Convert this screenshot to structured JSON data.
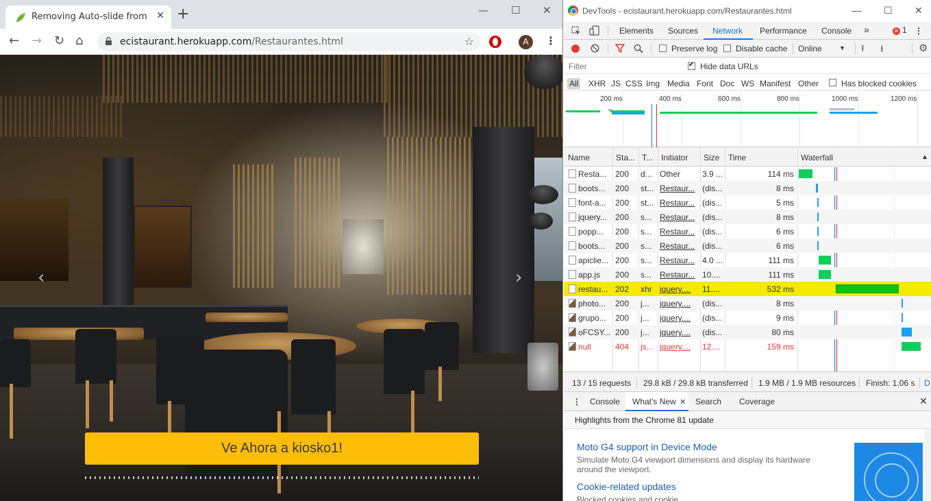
{
  "browser": {
    "tab_title": "Removing Auto-slide from Boots",
    "tab_close": "✕",
    "new_tab": "+",
    "win_min": "—",
    "win_max": "☐",
    "win_close": "✕",
    "url_host": "ecistaurant.herokuapp.com",
    "url_path": "/Restaurantes.html",
    "avatar_letter": "A",
    "back": "←",
    "forward": "→",
    "reload": "↻",
    "home": "⌂",
    "star": "☆",
    "menu": "⋮"
  },
  "page": {
    "cta_label": "Ve Ahora a kiosko1!",
    "prev_arrow": "‹",
    "next_arrow": "›"
  },
  "devtools": {
    "window_title": "DevTools - ecistaurant.herokuapp.com/Restaurantes.html",
    "win_min": "—",
    "win_max": "☐",
    "win_close": "✕",
    "tabs": [
      "Elements",
      "Sources",
      "Network",
      "Performance",
      "Console"
    ],
    "more_tabs": "»",
    "error_count": "1",
    "menu": "⋮",
    "close": "✕",
    "toolbar": {
      "preserve_log": "Preserve log",
      "disable_cache": "Disable cache",
      "throttle": "Online",
      "throttle_caret": "▼"
    },
    "filter_placeholder": "Filter",
    "hide_data_urls": "Hide data URLs",
    "types": [
      "All",
      "XHR",
      "JS",
      "CSS",
      "Img",
      "Media",
      "Font",
      "Doc",
      "WS",
      "Manifest",
      "Other"
    ],
    "has_blocked_cookies": "Has blocked cookies",
    "overview_ticks": [
      "200 ms",
      "400 ms",
      "600 ms",
      "800 ms",
      "1000 ms",
      "1200 ms"
    ],
    "columns": [
      "Name",
      "Sta...",
      "T...",
      "Initiator",
      "Size",
      "Time",
      "Waterfall"
    ],
    "sort_arrow": "▲",
    "rows": [
      {
        "name": "Resta...",
        "status": "200",
        "type": "d...",
        "initiator": "Other",
        "size": "3.9 ...",
        "time": "114 ms"
      },
      {
        "name": "boots...",
        "status": "200",
        "type": "st...",
        "initiator": "Restaur...",
        "size": "(dis...",
        "time": "8 ms"
      },
      {
        "name": "font-a...",
        "status": "200",
        "type": "st...",
        "initiator": "Restaur...",
        "size": "(dis...",
        "time": "5 ms"
      },
      {
        "name": "jquery...",
        "status": "200",
        "type": "s...",
        "initiator": "Restaur...",
        "size": "(dis...",
        "time": "8 ms"
      },
      {
        "name": "popp...",
        "status": "200",
        "type": "s...",
        "initiator": "Restaur...",
        "size": "(dis...",
        "time": "6 ms"
      },
      {
        "name": "boots...",
        "status": "200",
        "type": "s...",
        "initiator": "Restaur...",
        "size": "(dis...",
        "time": "6 ms"
      },
      {
        "name": "apiclie...",
        "status": "200",
        "type": "s...",
        "initiator": "Restaur...",
        "size": "4.0 ...",
        "time": "111 ms"
      },
      {
        "name": "app.js",
        "status": "200",
        "type": "s...",
        "initiator": "Restaur...",
        "size": "10....",
        "time": "111 ms"
      },
      {
        "name": "restau...",
        "status": "202",
        "type": "xhr",
        "initiator": "jquery....",
        "size": "11....",
        "time": "532 ms"
      },
      {
        "name": "photo...",
        "status": "200",
        "type": "j...",
        "initiator": "jquery....",
        "size": "(dis...",
        "time": "8 ms"
      },
      {
        "name": "grupo...",
        "status": "200",
        "type": "j...",
        "initiator": "jquery....",
        "size": "(dis...",
        "time": "9 ms"
      },
      {
        "name": "oFCSY...",
        "status": "200",
        "type": "j...",
        "initiator": "jquery....",
        "size": "(dis...",
        "time": "80 ms"
      },
      {
        "name": "null",
        "status": "404",
        "type": "js...",
        "initiator": "jquery....",
        "size": "12....",
        "time": "159 ms"
      }
    ],
    "summary": {
      "requests": "13 / 15 requests",
      "transferred": "29.8 kB / 29.8 kB transferred",
      "resources": "1.9 MB / 1.9 MB resources",
      "finish": "Finish: 1.06 s",
      "cut": "D"
    },
    "drawer_tabs": [
      "Console",
      "What's New",
      "Search",
      "Coverage"
    ],
    "drawer_tab_close": "✕",
    "whats_new_header": "Highlights from the Chrome 81 update",
    "whats_new": [
      {
        "title": "Moto G4 support in Device Mode",
        "desc": "Simulate Moto G4 viewport dimensions and display its hardware around the viewport."
      },
      {
        "title": "Cookie-related updates",
        "desc": "Blocked cookies and cookie"
      }
    ],
    "colors": {
      "accent": "#1a73e8",
      "highlight_row": "#f3ea00",
      "bar_green": "#0fcf5a",
      "bar_blue": "#1da1f2",
      "error_red": "#e53935"
    }
  }
}
